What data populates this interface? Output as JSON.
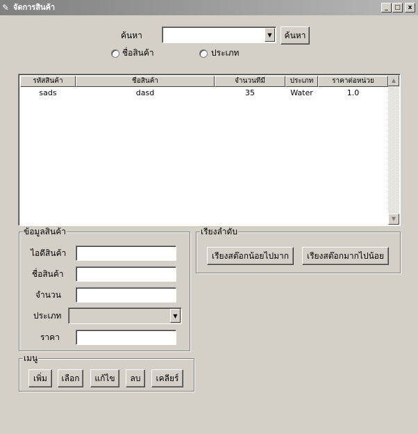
{
  "window": {
    "title": "จัดการสินค้า",
    "app_icon": "feather-icon",
    "minimize": "_",
    "maximize": "□",
    "close": "x"
  },
  "search": {
    "label": "ค้นหา",
    "value": "",
    "button": "ค้นหา",
    "radio_name": "ชื่อสินค้า",
    "radio_type": "ประเภท"
  },
  "table": {
    "columns": [
      "รหัสสินค้า",
      "ชื่อสินค้า",
      "จำนวนที่มี",
      "ประเภท",
      "ราคาต่อหน่วย"
    ],
    "rows": [
      [
        "sads",
        "dasd",
        "35",
        "Water",
        "1.0"
      ]
    ]
  },
  "product_info": {
    "legend": "ข้อมูลสินค้า",
    "id_label": "ไอดีสินค้า",
    "name_label": "ชื่อสินค้า",
    "qty_label": "จำนวน",
    "type_label": "ประเภท",
    "price_label": "ราคา",
    "id_value": "",
    "name_value": "",
    "qty_value": "",
    "type_value": "",
    "price_value": ""
  },
  "sort": {
    "legend": "เรียงลำดับ",
    "asc_button": "เรียงสต๊อกน้อยไปมาก",
    "desc_button": "เรียงสต๊อกมากไปน้อย"
  },
  "menu": {
    "legend": "เมนู",
    "add": "เพิ่ม",
    "select": "เลือก",
    "edit": "แก้ไข",
    "delete": "ลบ",
    "clear": "เคลียร์"
  }
}
